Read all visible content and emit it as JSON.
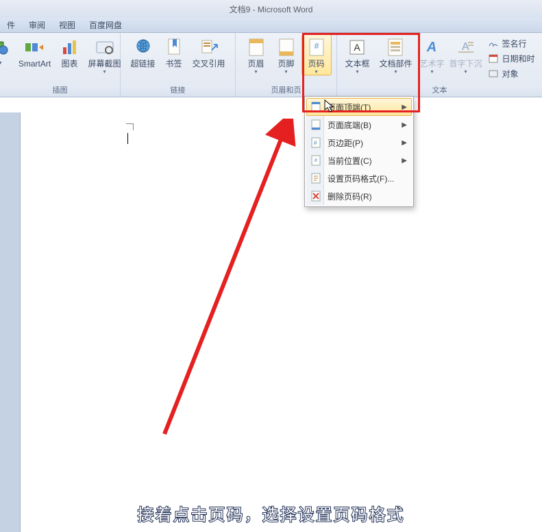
{
  "title": "文档9 - Microsoft Word",
  "tabs": [
    "件",
    "审阅",
    "视图",
    "百度网盘"
  ],
  "ribbon": {
    "groups": [
      {
        "label": "插图",
        "buttons": [
          {
            "label": "SmartArt",
            "arrow": false
          },
          {
            "label": "图表",
            "arrow": false
          },
          {
            "label": "屏幕截图",
            "arrow": true
          }
        ]
      },
      {
        "label": "链接",
        "buttons": [
          {
            "label": "超链接",
            "arrow": false
          },
          {
            "label": "书签",
            "arrow": false
          },
          {
            "label": "交叉引用",
            "arrow": false
          }
        ]
      },
      {
        "label": "页眉和页",
        "buttons": [
          {
            "label": "页眉",
            "arrow": true
          },
          {
            "label": "页脚",
            "arrow": true
          },
          {
            "label": "页码",
            "arrow": true
          }
        ]
      },
      {
        "label": "文本",
        "buttons": [
          {
            "label": "文本框",
            "arrow": true
          },
          {
            "label": "文档部件",
            "arrow": true
          },
          {
            "label": "艺术字",
            "arrow": true
          },
          {
            "label": "首字下沉",
            "arrow": true
          }
        ],
        "small": [
          {
            "label": "签名行"
          },
          {
            "label": "日期和时"
          },
          {
            "label": "对象"
          }
        ]
      }
    ]
  },
  "menu": {
    "items": [
      {
        "label": "页面顶端(T)",
        "sub": true
      },
      {
        "label": "页面底端(B)",
        "sub": true
      },
      {
        "label": "页边距(P)",
        "sub": true
      },
      {
        "label": "当前位置(C)",
        "sub": true
      },
      {
        "label": "设置页码格式(F)...",
        "sub": false
      },
      {
        "label": "删除页码(R)",
        "sub": false
      }
    ]
  },
  "caption": "接着点击页码，选择设置页码格式"
}
